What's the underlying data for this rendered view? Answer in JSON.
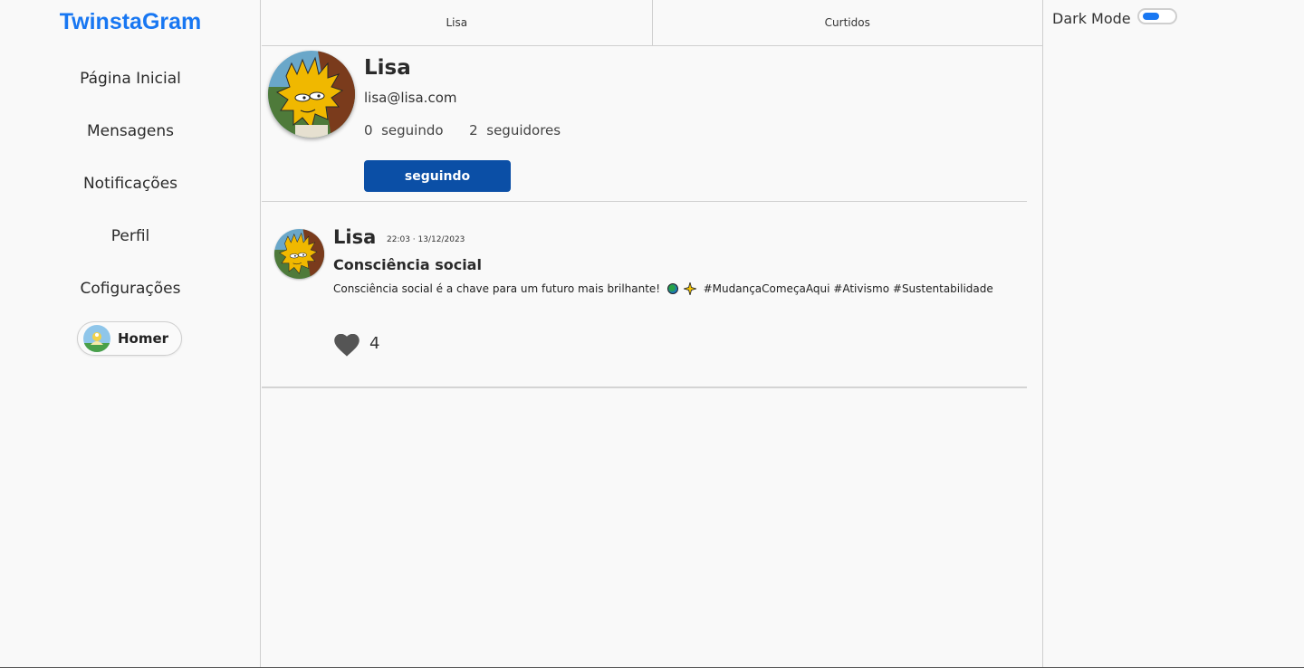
{
  "app": {
    "logo": "TwinstaGram"
  },
  "sidebar": {
    "items": [
      {
        "label": "Página Inicial"
      },
      {
        "label": "Mensagens"
      },
      {
        "label": "Notificações"
      },
      {
        "label": "Perfil"
      },
      {
        "label": "Cofigurações"
      }
    ],
    "current_user": {
      "name": "Homer"
    }
  },
  "tabs": [
    {
      "label": "Lisa"
    },
    {
      "label": "Curtidos"
    }
  ],
  "profile": {
    "name": "Lisa",
    "email": "lisa@lisa.com",
    "following_count": "0",
    "following_label": "seguindo",
    "followers_count": "2",
    "followers_label": "seguidores",
    "follow_button_label": "seguindo"
  },
  "post": {
    "author": "Lisa",
    "timestamp": "22:03 · 13/12/2023",
    "title": "Consciência social",
    "body_text": "Consciência social é a chave para um futuro mais brilhante!",
    "hashtags": "#MudançaComeçaAqui #Ativismo #Sustentabilidade",
    "likes": "4"
  },
  "settings": {
    "dark_mode_label": "Dark Mode",
    "dark_mode_on": false
  },
  "colors": {
    "brand": "#1877f2",
    "button": "#0b4fa6",
    "like_icon": "#555555"
  },
  "icons": {
    "like": "heart-icon",
    "globe": "globe-emoji-icon",
    "sparkle": "sparkle-emoji-icon"
  }
}
